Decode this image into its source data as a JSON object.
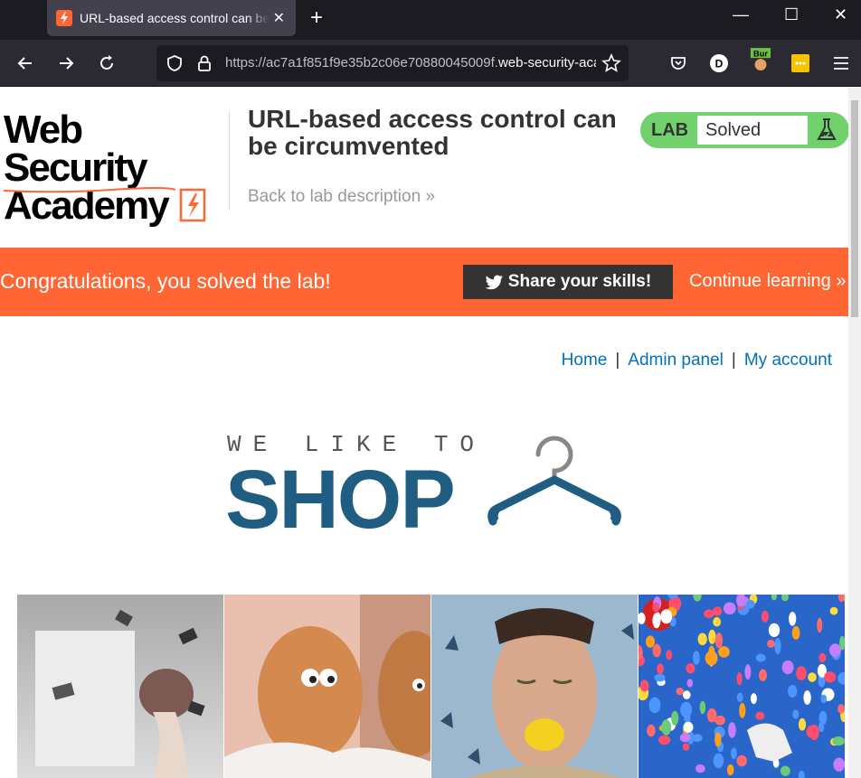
{
  "browser": {
    "tab_title": "URL-based access control can be circumvented",
    "tab_close": "✕",
    "new_tab": "+",
    "url_prefix": "https://ac7a1f851f9e35b2c06e70880045009f.",
    "url_domain": "web-security-academy.net",
    "window_minimize": "—",
    "window_maximize": "☐",
    "window_close": "✕"
  },
  "header": {
    "logo_line1": "Web Security",
    "logo_line2": "Academy",
    "lab_title": "URL-based access control can be circumvented",
    "back_link": "Back to lab description »",
    "lab_label": "LAB",
    "lab_status": "Solved"
  },
  "banner": {
    "congrats": "Congratulations, you solved the lab!",
    "share": "Share your skills!",
    "continue": "Continue learning »"
  },
  "nav": {
    "home": "Home",
    "admin": "Admin panel",
    "account": "My account",
    "separator": "|"
  },
  "shop": {
    "tagline": "WE LIKE TO",
    "word": "SHOP"
  },
  "colors": {
    "accent_orange": "#ff6633",
    "lab_green": "#70d16d",
    "link_blue": "#0071bc",
    "shop_blue": "#1f5e82"
  }
}
